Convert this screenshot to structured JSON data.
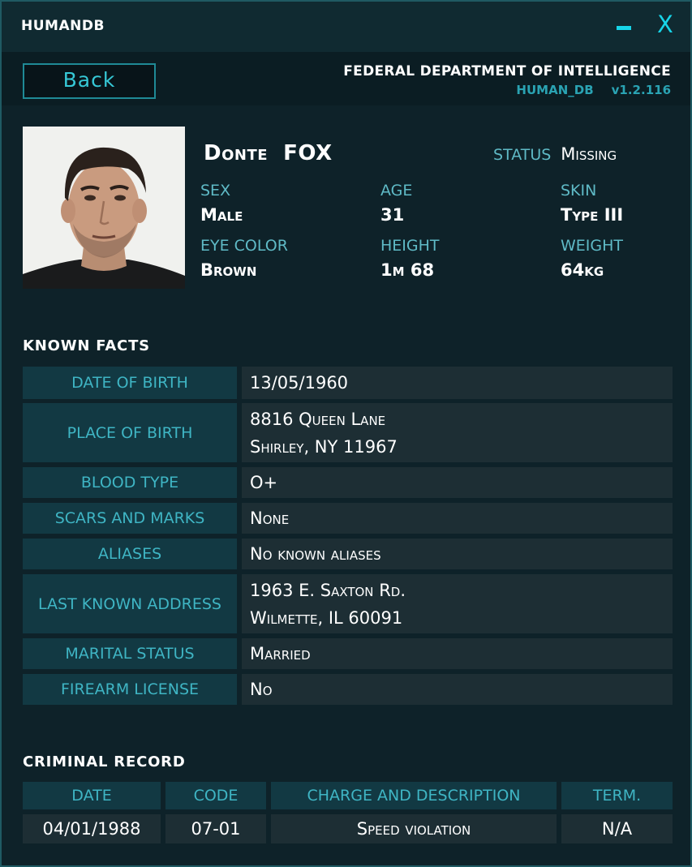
{
  "window": {
    "title": "HUMANDB",
    "minimize_symbol": "–",
    "close_symbol": "X"
  },
  "header": {
    "back_label": "Back",
    "agency": "FEDERAL DEPARTMENT OF INTELLIGENCE",
    "db_name": "HUMAN_DB",
    "version": "v1.2.116"
  },
  "subject": {
    "first_name": "Donte",
    "last_name": "FOX",
    "status_label": "STATUS",
    "status_value": "Missing",
    "fields": {
      "sex_label": "SEX",
      "sex": "Male",
      "age_label": "AGE",
      "age": "31",
      "skin_label": "SKIN",
      "skin": "Type III",
      "eye_label": "EYE COLOR",
      "eye": "Brown",
      "height_label": "HEIGHT",
      "height": "1m 68",
      "weight_label": "WEIGHT",
      "weight": "64kg"
    }
  },
  "known_facts": {
    "title": "KNOWN  FACTS",
    "rows": [
      {
        "label": "DATE OF BIRTH",
        "lines": [
          "13/05/1960"
        ]
      },
      {
        "label": "PLACE OF BIRTH",
        "lines": [
          "8816 Queen  Lane",
          "Shirley, NY 11967"
        ]
      },
      {
        "label": "BLOOD TYPE",
        "lines": [
          "O+"
        ]
      },
      {
        "label": "SCARS AND MARKS",
        "lines": [
          "None"
        ]
      },
      {
        "label": "ALIASES",
        "lines": [
          "No known aliases"
        ]
      },
      {
        "label": "LAST KNOWN ADDRESS",
        "lines": [
          "1963 E. Saxton Rd.",
          "Wilmette, IL 60091"
        ]
      },
      {
        "label": "MARITAL STATUS",
        "lines": [
          "Married"
        ]
      },
      {
        "label": "FIREARM LICENSE",
        "lines": [
          "No"
        ]
      }
    ]
  },
  "criminal_record": {
    "title": "CRIMINAL  RECORD",
    "columns": [
      "DATE",
      "CODE",
      "CHARGE AND DESCRIPTION",
      "TERM."
    ],
    "rows": [
      [
        "04/01/1988",
        "07-01",
        "Speed violation",
        "N/A"
      ]
    ]
  },
  "colors": {
    "accent": "#17d4e8",
    "label": "#5fbac6",
    "cell_label_bg": "#123943",
    "cell_value_bg": "#1d2e34"
  }
}
